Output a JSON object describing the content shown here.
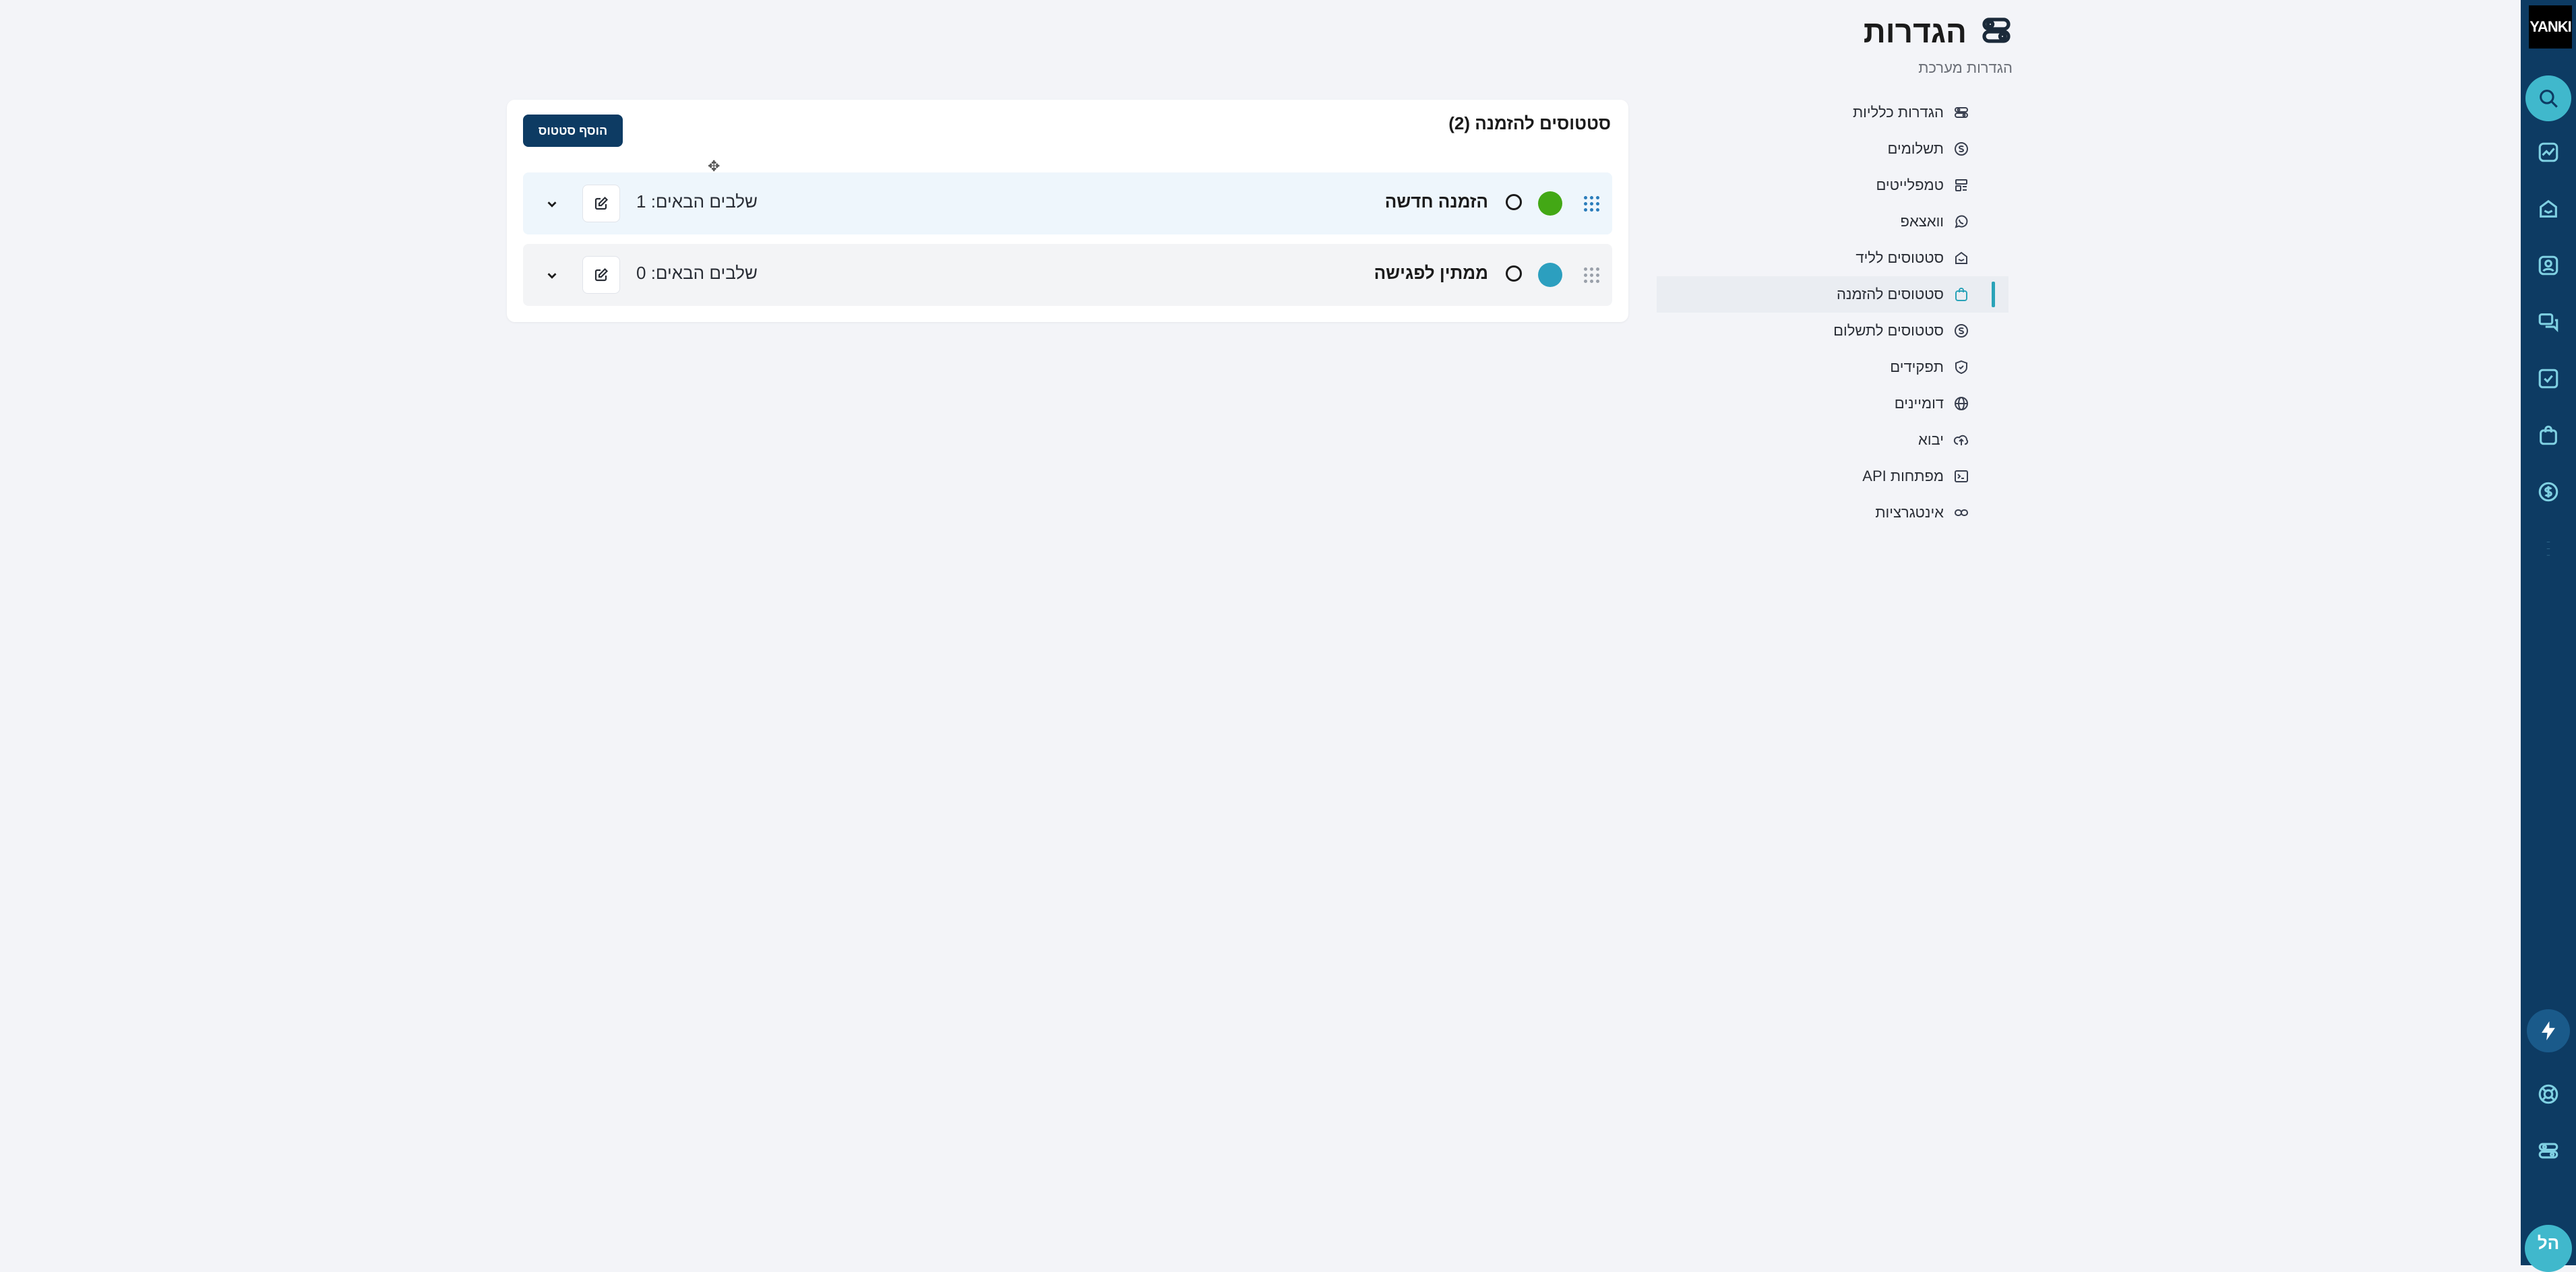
{
  "header": {
    "title": "הגדרות",
    "subtitle": "הגדרות מערכת"
  },
  "rail": {
    "logo": "YANKI",
    "user_initials": "הל",
    "icons": [
      "search-icon",
      "chart-icon",
      "home-icon",
      "contact-icon",
      "chat-icon",
      "task-icon",
      "bag-icon",
      "dollar-icon",
      "more-icon",
      "bolt-icon",
      "help-icon",
      "settings-icon"
    ]
  },
  "settings_nav": {
    "items": [
      {
        "label": "הגדרות כלליות",
        "icon": "sliders-icon"
      },
      {
        "label": "תשלומים",
        "icon": "dollar-circle-icon"
      },
      {
        "label": "טמפלייטים",
        "icon": "template-icon"
      },
      {
        "label": "וואצאפ",
        "icon": "whatsapp-icon"
      },
      {
        "label": "סטטוסים לליד",
        "icon": "lead-icon"
      },
      {
        "label": "סטטוסים להזמנה",
        "icon": "bag-icon",
        "active": true
      },
      {
        "label": "סטטוסים לתשלום",
        "icon": "dollar-circle-icon"
      },
      {
        "label": "תפקידים",
        "icon": "shield-icon"
      },
      {
        "label": "דומיינים",
        "icon": "globe-icon"
      },
      {
        "label": "יבוא",
        "icon": "upload-cloud-icon"
      },
      {
        "label": "מפתחות API",
        "icon": "terminal-icon"
      },
      {
        "label": "אינטגרציות",
        "icon": "link-icon"
      }
    ]
  },
  "main": {
    "card_title": "סטטוסים להזמנה (2)",
    "add_button_label": "הוסף סטטוס",
    "statuses": [
      {
        "name": "הזמנה חדשה",
        "color": "#43a815",
        "next_steps": "שלבים הבאים: 1"
      },
      {
        "name": "ממתין לפגישה",
        "color": "#2c9fbf",
        "next_steps": "שלבים הבאים: 0"
      }
    ]
  },
  "colors": {
    "rail_bg": "#0d3b63",
    "accent": "#2aa3b8",
    "primary_button": "#0d3b63"
  }
}
